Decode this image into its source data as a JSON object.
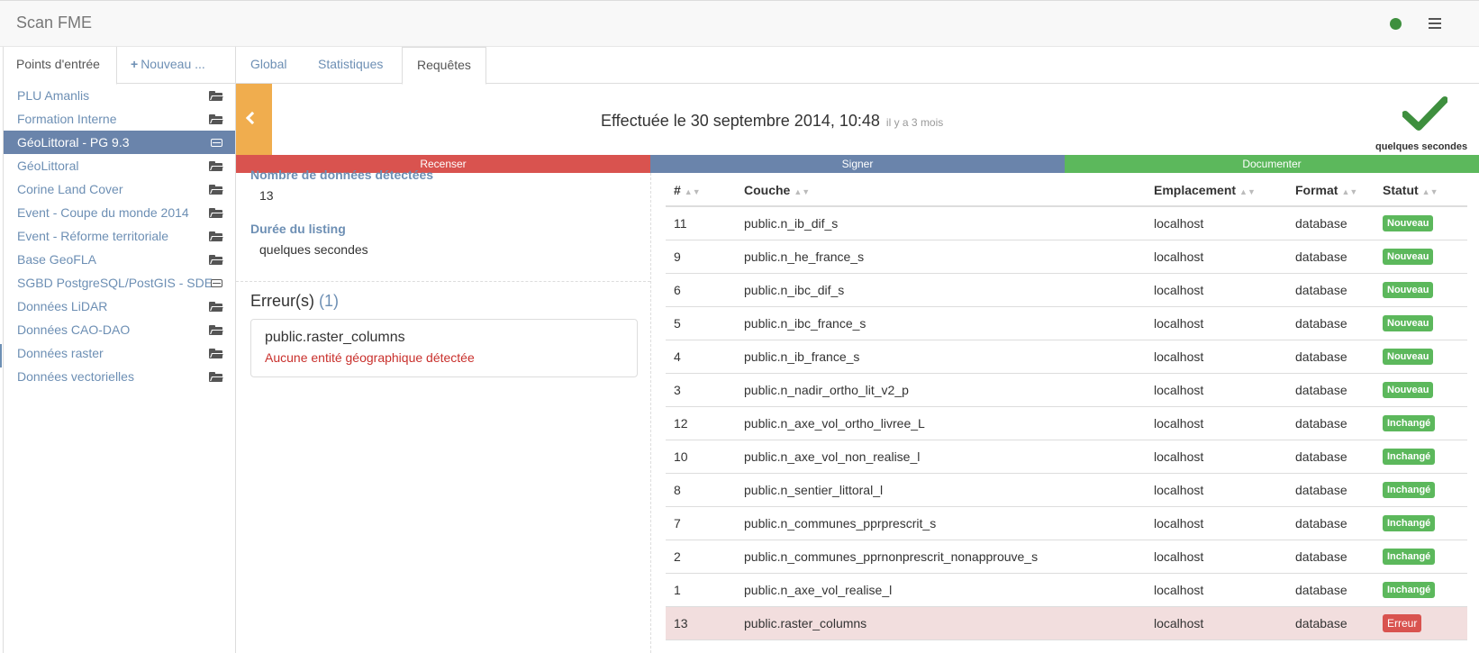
{
  "app": {
    "title": "Scan FME"
  },
  "left_tabs": {
    "entry_points": "Points d'entrée",
    "new": "Nouveau ..."
  },
  "entries": [
    {
      "label": "PLU Amanlis",
      "icon": "folder-open-icon"
    },
    {
      "label": "Formation Interne",
      "icon": "folder-open-icon"
    },
    {
      "label": "GéoLittoral - PG 9.3",
      "icon": "hard-drive-icon",
      "active": true
    },
    {
      "label": "GéoLittoral",
      "icon": "folder-open-icon"
    },
    {
      "label": "Corine Land Cover",
      "icon": "folder-open-icon"
    },
    {
      "label": "Event - Coupe du monde 2014",
      "icon": "folder-open-icon"
    },
    {
      "label": "Event - Réforme territoriale",
      "icon": "folder-open-icon"
    },
    {
      "label": "Base GeoFLA",
      "icon": "folder-open-icon"
    },
    {
      "label": "SGBD PostgreSQL/PostGIS - SDE",
      "icon": "hard-drive-icon"
    },
    {
      "label": "Données LiDAR",
      "icon": "folder-open-icon"
    },
    {
      "label": "Données CAO-DAO",
      "icon": "folder-open-icon"
    },
    {
      "label": "Données raster",
      "icon": "folder-open-icon"
    },
    {
      "label": "Données vectorielles",
      "icon": "folder-open-icon"
    }
  ],
  "right_tabs": {
    "global": "Global",
    "stats": "Statistiques",
    "requests": "Requêtes"
  },
  "header": {
    "title": "Effectuée le 30 septembre 2014, 10:48",
    "ago": "il y a 3 mois",
    "duration_badge": "quelques secondes"
  },
  "steps": {
    "s1": "Recenser",
    "s2": "Signer",
    "s3": "Documenter"
  },
  "summary": {
    "detected_label": "Nombre de données détectées",
    "detected_value": "13",
    "duration_label": "Durée du listing",
    "duration_value": "quelques secondes"
  },
  "errors": {
    "title": "Erreur(s)",
    "count": "(1)",
    "item_name": "public.raster_columns",
    "item_msg": "Aucune entité géographique détectée"
  },
  "table": {
    "headers": {
      "id": "#",
      "layer": "Couche",
      "location": "Emplacement",
      "format": "Format",
      "status": "Statut"
    },
    "rows": [
      {
        "id": "11",
        "layer": "public.n_ib_dif_s",
        "location": "localhost",
        "format": "database",
        "status": "Nouveau"
      },
      {
        "id": "9",
        "layer": "public.n_he_france_s",
        "location": "localhost",
        "format": "database",
        "status": "Nouveau"
      },
      {
        "id": "6",
        "layer": "public.n_ibc_dif_s",
        "location": "localhost",
        "format": "database",
        "status": "Nouveau"
      },
      {
        "id": "5",
        "layer": "public.n_ibc_france_s",
        "location": "localhost",
        "format": "database",
        "status": "Nouveau"
      },
      {
        "id": "4",
        "layer": "public.n_ib_france_s",
        "location": "localhost",
        "format": "database",
        "status": "Nouveau"
      },
      {
        "id": "3",
        "layer": "public.n_nadir_ortho_lit_v2_p",
        "location": "localhost",
        "format": "database",
        "status": "Nouveau"
      },
      {
        "id": "12",
        "layer": "public.n_axe_vol_ortho_livree_L",
        "location": "localhost",
        "format": "database",
        "status": "Inchangé"
      },
      {
        "id": "10",
        "layer": "public.n_axe_vol_non_realise_l",
        "location": "localhost",
        "format": "database",
        "status": "Inchangé"
      },
      {
        "id": "8",
        "layer": "public.n_sentier_littoral_l",
        "location": "localhost",
        "format": "database",
        "status": "Inchangé"
      },
      {
        "id": "7",
        "layer": "public.n_communes_pprprescrit_s",
        "location": "localhost",
        "format": "database",
        "status": "Inchangé"
      },
      {
        "id": "2",
        "layer": "public.n_communes_pprnonprescrit_nonapprouve_s",
        "location": "localhost",
        "format": "database",
        "status": "Inchangé"
      },
      {
        "id": "1",
        "layer": "public.n_axe_vol_realise_l",
        "location": "localhost",
        "format": "database",
        "status": "Inchangé"
      },
      {
        "id": "13",
        "layer": "public.raster_columns",
        "location": "localhost",
        "format": "database",
        "status": "Erreur",
        "error": true
      }
    ]
  },
  "colors": {
    "accent": "#6a84ab",
    "warning": "#f0ad4e",
    "danger": "#d9534f",
    "success": "#5cb85c"
  }
}
